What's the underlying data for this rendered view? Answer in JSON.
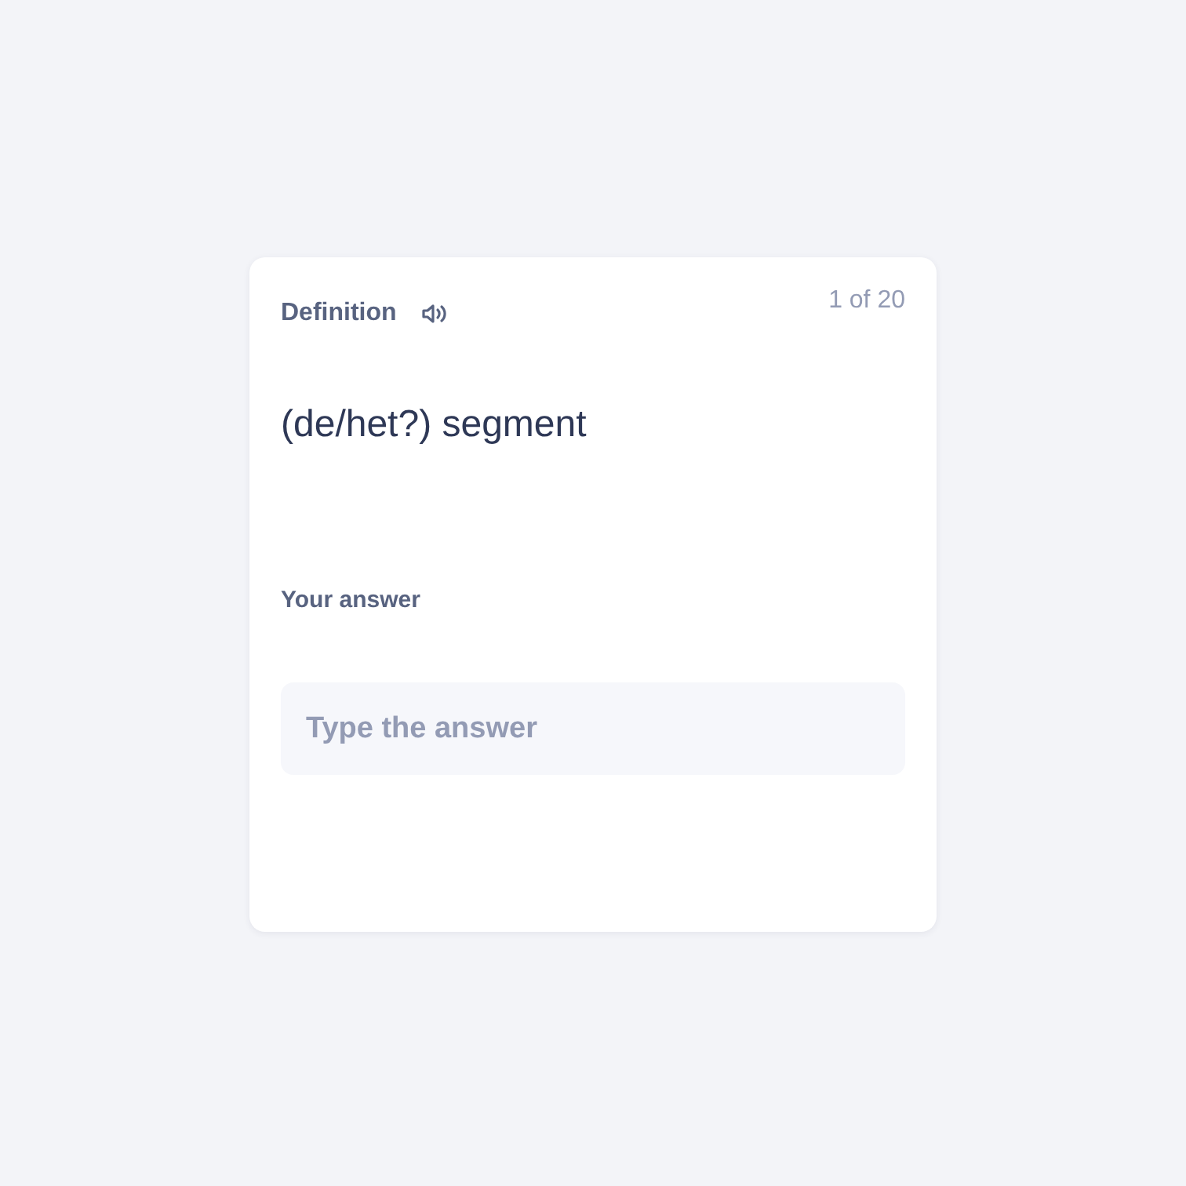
{
  "card": {
    "header": {
      "label": "Definition",
      "counter": "1 of 20"
    },
    "term": "(de/het?) segment",
    "answer": {
      "label": "Your answer",
      "placeholder": "Type the answer"
    }
  }
}
